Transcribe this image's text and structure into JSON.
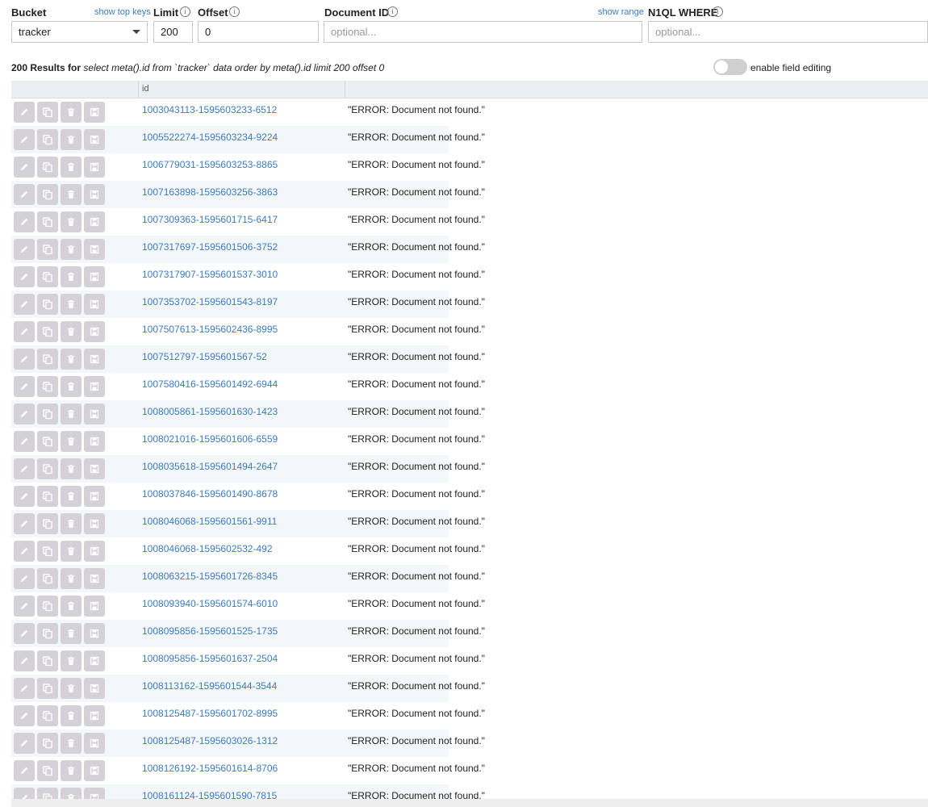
{
  "filters": {
    "bucket_label": "Bucket",
    "show_top_keys": "show top keys",
    "bucket_value": "tracker",
    "limit_label": "Limit",
    "limit_value": "200",
    "offset_label": "Offset",
    "offset_value": "0",
    "docid_label": "Document ID",
    "show_range": "show range",
    "docid_placeholder": "optional...",
    "where_label": "N1QL WHERE",
    "where_placeholder": "optional..."
  },
  "summary": {
    "count_text": "200 Results for",
    "query": "select meta().id from `tracker` data order by meta().id limit 200 offset 0",
    "toggle_label": "enable field editing"
  },
  "table": {
    "header_id": "id",
    "rows": [
      {
        "id": "1003043113-1595603233-6512",
        "value": "\"ERROR: Document not found.\""
      },
      {
        "id": "1005522274-1595603234-9224",
        "value": "\"ERROR: Document not found.\""
      },
      {
        "id": "1006779031-1595603253-8865",
        "value": "\"ERROR: Document not found.\""
      },
      {
        "id": "1007163898-1595603256-3863",
        "value": "\"ERROR: Document not found.\""
      },
      {
        "id": "1007309363-1595601715-6417",
        "value": "\"ERROR: Document not found.\""
      },
      {
        "id": "1007317697-1595601506-3752",
        "value": "\"ERROR: Document not found.\""
      },
      {
        "id": "1007317907-1595601537-3010",
        "value": "\"ERROR: Document not found.\""
      },
      {
        "id": "1007353702-1595601543-8197",
        "value": "\"ERROR: Document not found.\""
      },
      {
        "id": "1007507613-1595602436-8995",
        "value": "\"ERROR: Document not found.\""
      },
      {
        "id": "1007512797-1595601567-52",
        "value": "\"ERROR: Document not found.\""
      },
      {
        "id": "1007580416-1595601492-6944",
        "value": "\"ERROR: Document not found.\""
      },
      {
        "id": "1008005861-1595601630-1423",
        "value": "\"ERROR: Document not found.\""
      },
      {
        "id": "1008021016-1595601606-6559",
        "value": "\"ERROR: Document not found.\""
      },
      {
        "id": "1008035618-1595601494-2647",
        "value": "\"ERROR: Document not found.\""
      },
      {
        "id": "1008037846-1595601490-8678",
        "value": "\"ERROR: Document not found.\""
      },
      {
        "id": "1008046068-1595601561-9911",
        "value": "\"ERROR: Document not found.\""
      },
      {
        "id": "1008046068-1595602532-492",
        "value": "\"ERROR: Document not found.\""
      },
      {
        "id": "1008063215-1595601726-8345",
        "value": "\"ERROR: Document not found.\""
      },
      {
        "id": "1008093940-1595601574-6010",
        "value": "\"ERROR: Document not found.\""
      },
      {
        "id": "1008095856-1595601525-1735",
        "value": "\"ERROR: Document not found.\""
      },
      {
        "id": "1008095856-1595601637-2504",
        "value": "\"ERROR: Document not found.\""
      },
      {
        "id": "1008113162-1595601544-3544",
        "value": "\"ERROR: Document not found.\""
      },
      {
        "id": "1008125487-1595601702-8995",
        "value": "\"ERROR: Document not found.\""
      },
      {
        "id": "1008125487-1595603026-1312",
        "value": "\"ERROR: Document not found.\""
      },
      {
        "id": "1008126192-1595601614-8706",
        "value": "\"ERROR: Document not found.\""
      },
      {
        "id": "1008161124-1595601590-7815",
        "value": "\"ERROR: Document not found.\""
      }
    ]
  },
  "row_action_icons": [
    "pencil-icon",
    "copy-icon",
    "trash-icon",
    "save-icon"
  ],
  "colors": {
    "link": "#3b7bc4",
    "button_bg": "#d4d2d8",
    "row_band": "#f4f7fa"
  }
}
